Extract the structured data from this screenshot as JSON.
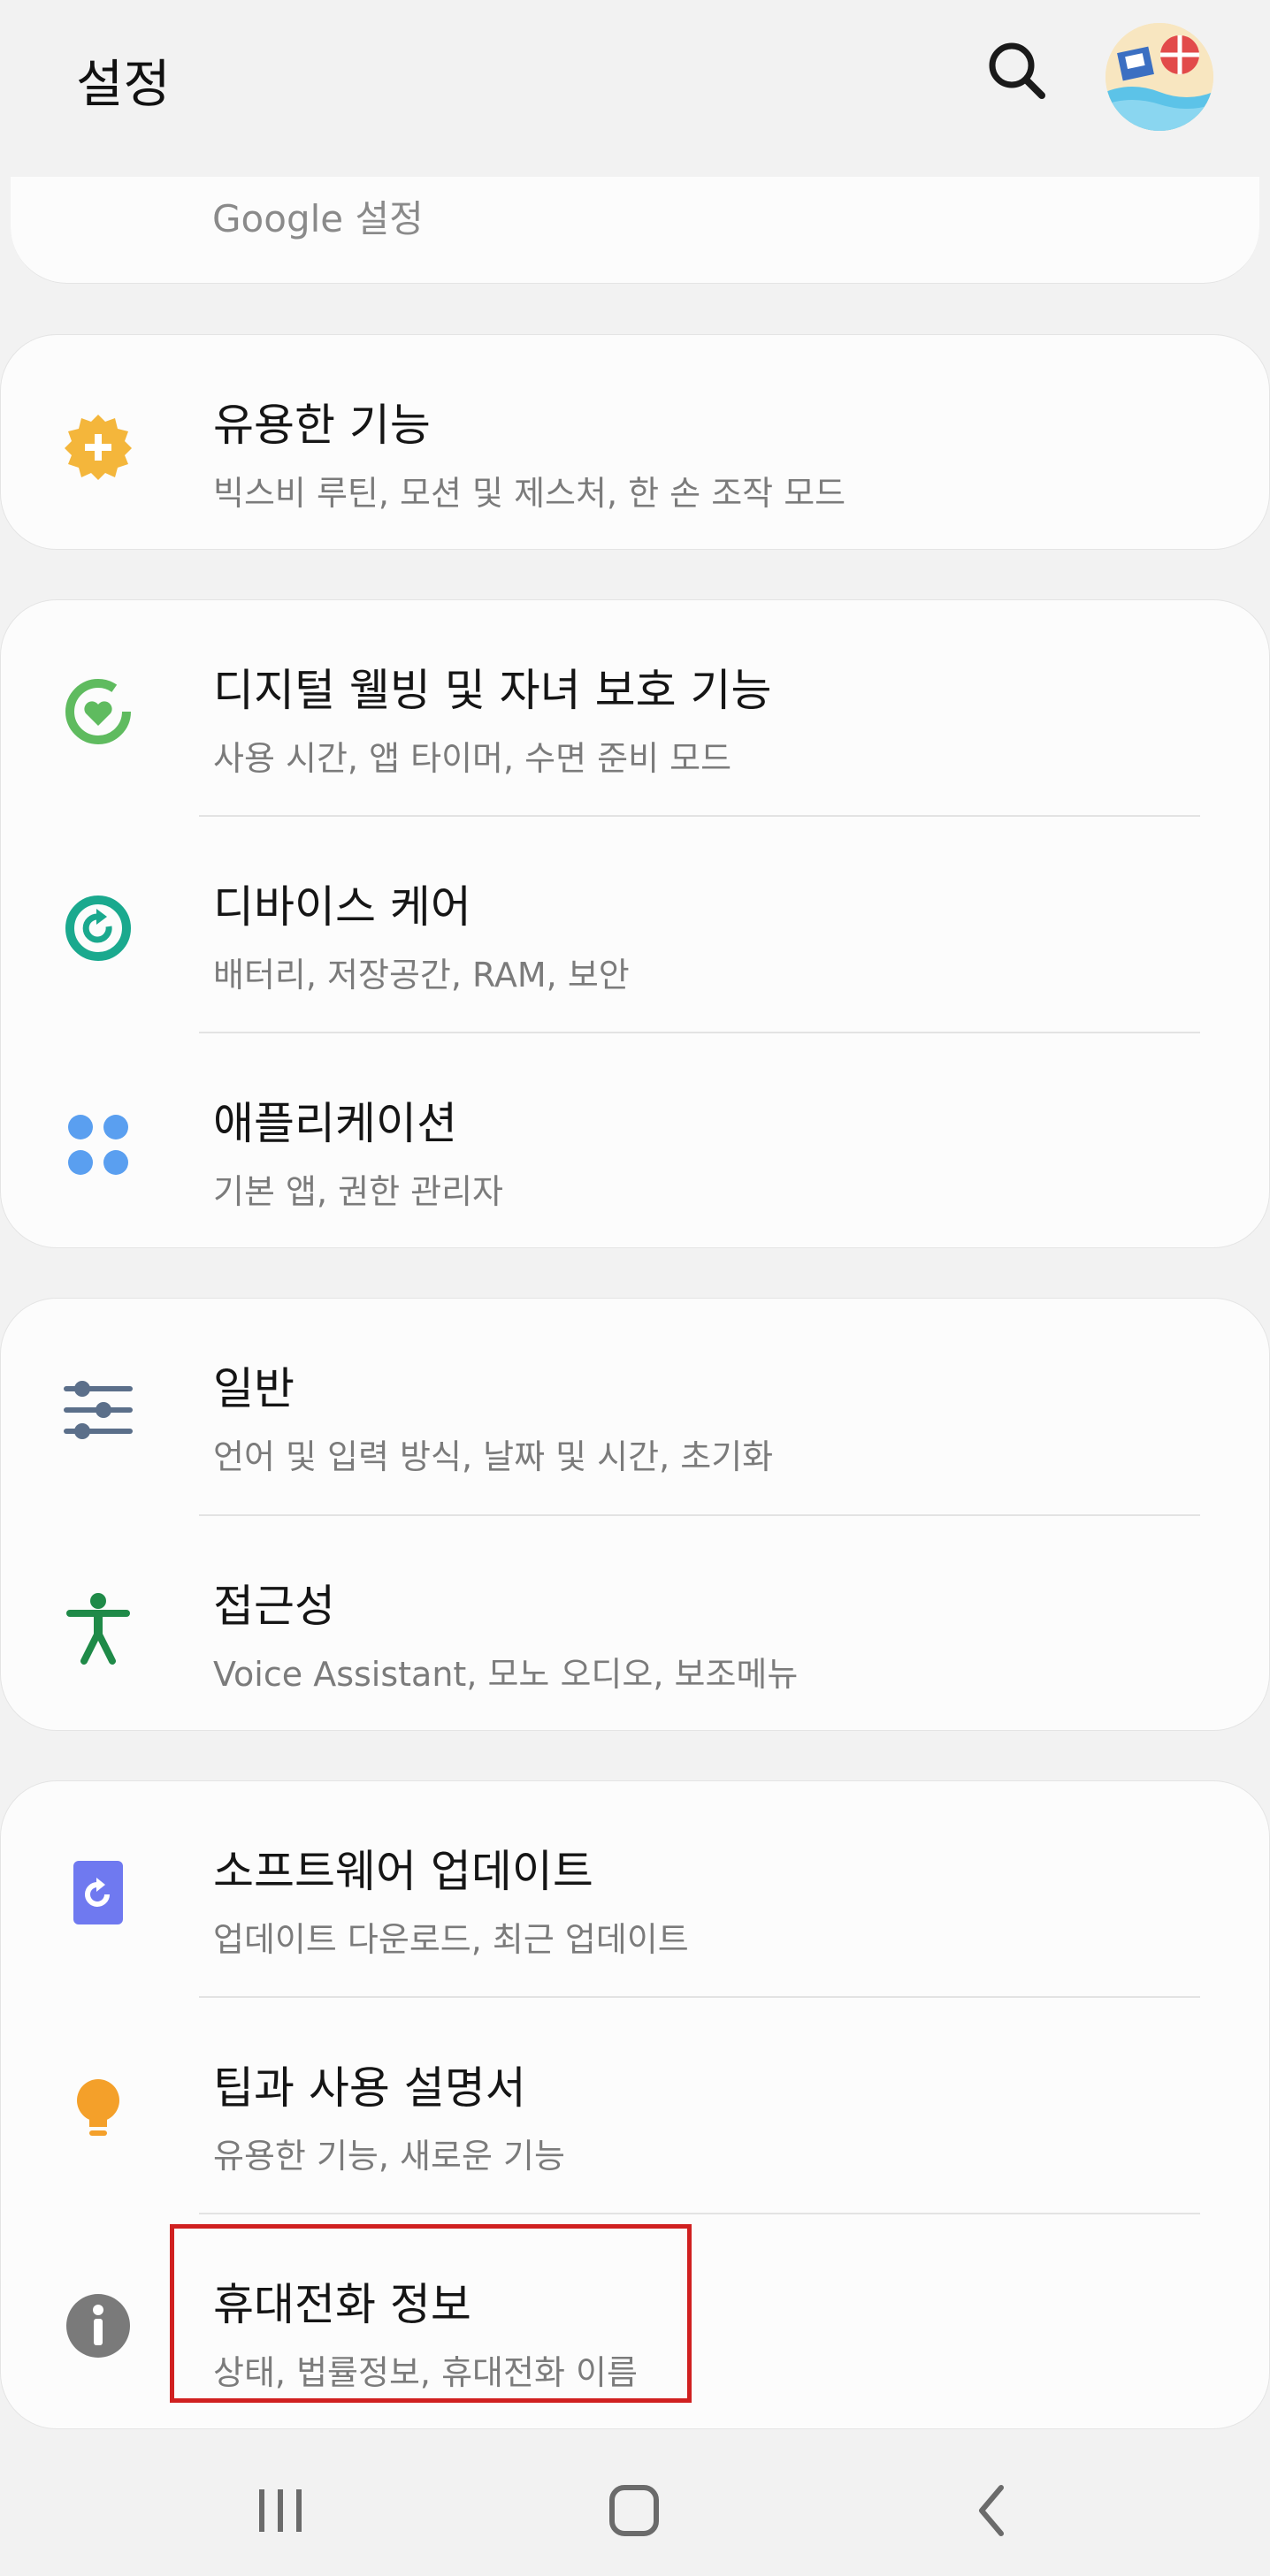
{
  "header": {
    "title": "설정",
    "search_icon": "search-icon",
    "avatar_icon": "profile-avatar"
  },
  "google_row": {
    "label": "Google 설정"
  },
  "items": [
    {
      "key": "useful",
      "title": "유용한 기능",
      "subtitle": "빅스비 루틴, 모션 및 제스처, 한 손 조작 모드",
      "icon": "gear-plus-icon",
      "icon_color": "#f4b63b"
    },
    {
      "key": "digital",
      "title": "디지털 웰빙 및 자녀 보호 기능",
      "subtitle": "사용 시간, 앱 타이머, 수면 준비 모드",
      "icon": "heart-circle-icon",
      "icon_color": "#5fbb5f"
    },
    {
      "key": "device",
      "title": "디바이스 케어",
      "subtitle": "배터리, 저장공간, RAM, 보안",
      "icon": "refresh-circle-icon",
      "icon_color": "#1aa98e"
    },
    {
      "key": "apps",
      "title": "애플리케이션",
      "subtitle": "기본 앱, 권한 관리자",
      "icon": "four-dots-icon",
      "icon_color": "#5a9ff0"
    },
    {
      "key": "general",
      "title": "일반",
      "subtitle": "언어 및 입력 방식, 날짜 및 시간, 초기화",
      "icon": "sliders-icon",
      "icon_color": "#5b6f8a"
    },
    {
      "key": "accessibility",
      "title": "접근성",
      "subtitle": "Voice Assistant, 모노 오디오, 보조메뉴",
      "icon": "person-icon",
      "icon_color": "#1f8a48"
    },
    {
      "key": "update",
      "title": "소프트웨어 업데이트",
      "subtitle": "업데이트 다운로드, 최근 업데이트",
      "icon": "update-icon",
      "icon_color": "#6f79f0"
    },
    {
      "key": "tips",
      "title": "팁과 사용 설명서",
      "subtitle": "유용한 기능, 새로운 기능",
      "icon": "lightbulb-icon",
      "icon_color": "#f4a02a"
    },
    {
      "key": "about",
      "title": "휴대전화 정보",
      "subtitle": "상태, 법률정보, 휴대전화 이름",
      "icon": "info-icon",
      "icon_color": "#7a7a7a"
    }
  ],
  "navbar": {
    "recents_icon": "recents-icon",
    "home_icon": "home-icon",
    "back_icon": "back-icon"
  }
}
